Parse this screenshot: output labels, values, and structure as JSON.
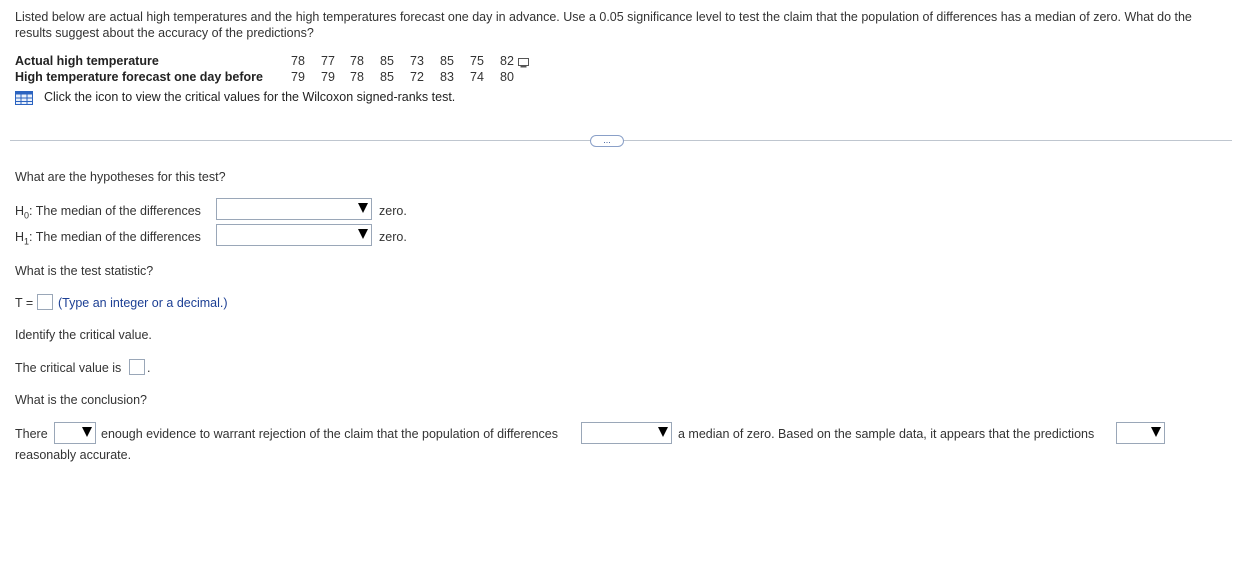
{
  "intro_text": "Listed below are actual high temperatures and the high temperatures forecast one day in advance. Use a 0.05 significance level to test the claim that the population of differences has a median of zero. What do the results suggest about the accuracy of the predictions?",
  "table": {
    "row1_label": "Actual high temperature",
    "row1_values": [
      "78",
      "77",
      "78",
      "85",
      "73",
      "85",
      "75",
      "82"
    ],
    "row2_label": "High temperature forecast one day before",
    "row2_values": [
      "79",
      "79",
      "78",
      "85",
      "72",
      "83",
      "74",
      "80"
    ]
  },
  "critical_values_link": "Click the icon to view the critical values for the Wilcoxon signed-ranks test.",
  "more_button": "...",
  "q1": {
    "prompt": "What are the hypotheses for this test?",
    "h0_prefix": "H",
    "h0_sub": "0",
    "h0_text": ": The median of the differences",
    "h1_prefix": "H",
    "h1_sub": "1",
    "h1_text": ": The median of the differences",
    "suffix": "zero."
  },
  "q2": {
    "prompt": "What is the test statistic?",
    "t_label": "T =",
    "hint": "(Type an integer or a decimal.)"
  },
  "q3": {
    "prompt": "Identify the critical value.",
    "label": "The critical value is",
    "end": "."
  },
  "q4": {
    "prompt": "What is the conclusion?",
    "part1": "There",
    "part2": "enough evidence to warrant rejection of the claim that the population of differences",
    "part3": "a median of zero. Based on the sample data, it appears that the predictions",
    "part4": "reasonably accurate."
  }
}
